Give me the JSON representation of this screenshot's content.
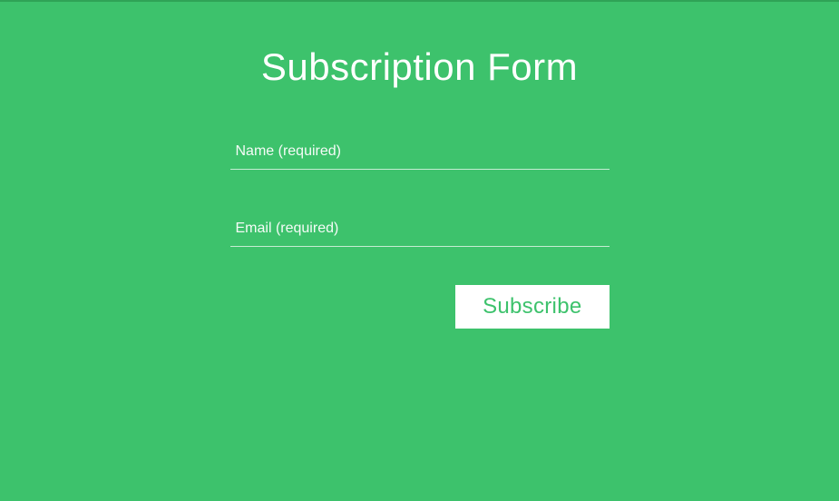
{
  "form": {
    "title": "Subscription Form",
    "fields": {
      "name": {
        "placeholder": "Name (required)",
        "value": ""
      },
      "email": {
        "placeholder": "Email (required)",
        "value": ""
      }
    },
    "submit_label": "Subscribe"
  },
  "colors": {
    "background": "#3dc26c",
    "text": "#ffffff",
    "button_bg": "#ffffff",
    "button_text": "#3dc26c"
  }
}
